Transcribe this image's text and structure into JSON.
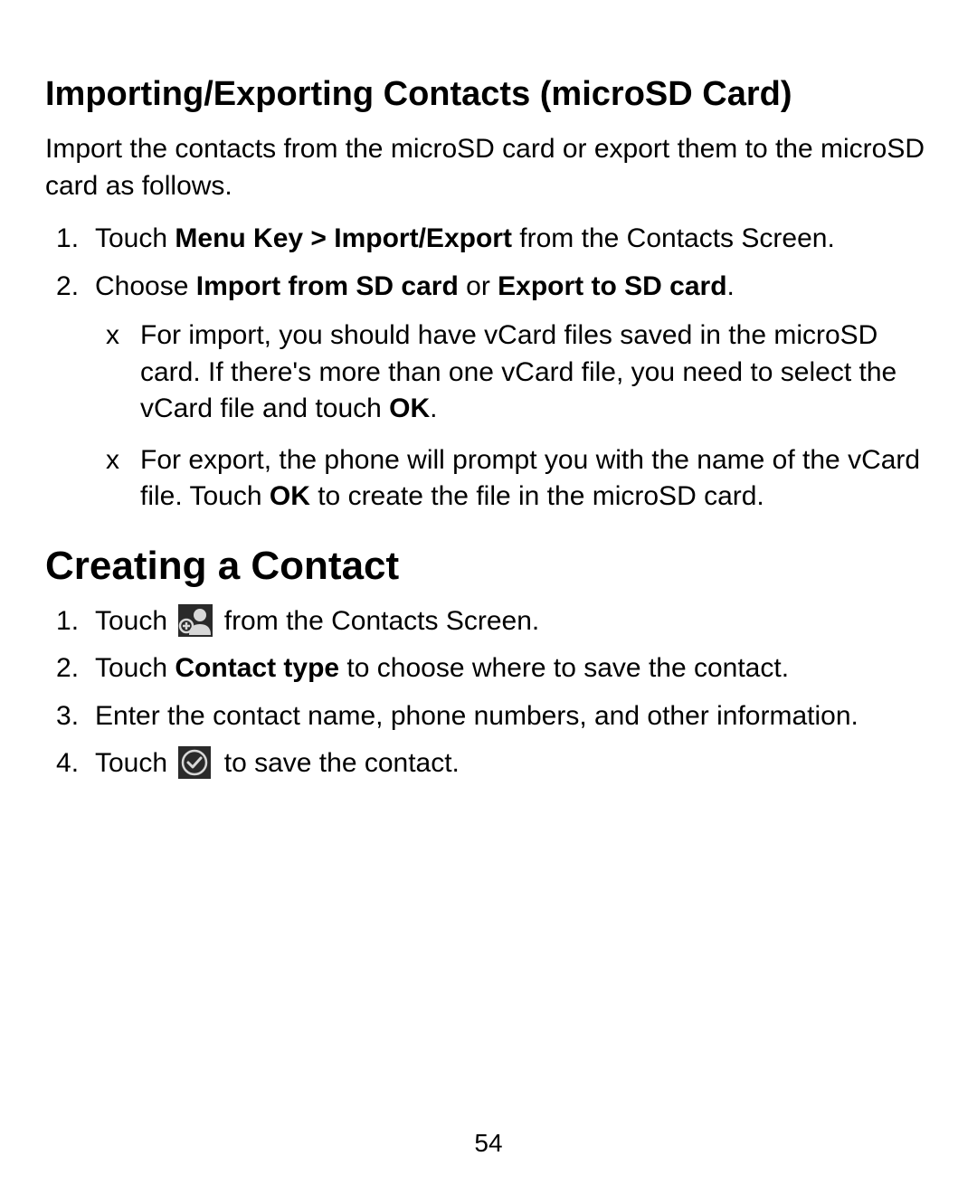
{
  "section1": {
    "heading": "Importing/Exporting Contacts (microSD Card)",
    "intro": "Import the contacts from the microSD card or export them to the microSD card as follows.",
    "step1_pre": "Touch ",
    "step1_bold": "Menu Key > Import/Export",
    "step1_post": " from the Contacts Screen.",
    "step2_pre": "Choose ",
    "step2_bold1": "Import from SD card",
    "step2_mid": " or ",
    "step2_bold2": "Export to SD card",
    "step2_post": ".",
    "sub1_pre": "For import, you should have vCard files saved in the microSD card. If there's more than one vCard file, you need to select the vCard file and touch ",
    "sub1_bold": "OK",
    "sub1_post": ".",
    "sub2_pre": "For export, the phone will prompt you with the name of the vCard file. Touch ",
    "sub2_bold": "OK",
    "sub2_post": " to create the file in the microSD card."
  },
  "section2": {
    "heading": "Creating a Contact",
    "step1_pre": "Touch ",
    "step1_post": " from the Contacts Screen.",
    "step2_pre": "Touch ",
    "step2_bold": "Contact type",
    "step2_post": " to choose where to save the contact.",
    "step3": "Enter the contact name, phone numbers, and other information.",
    "step4_pre": "Touch ",
    "step4_post": " to save the contact."
  },
  "pageNumber": "54"
}
